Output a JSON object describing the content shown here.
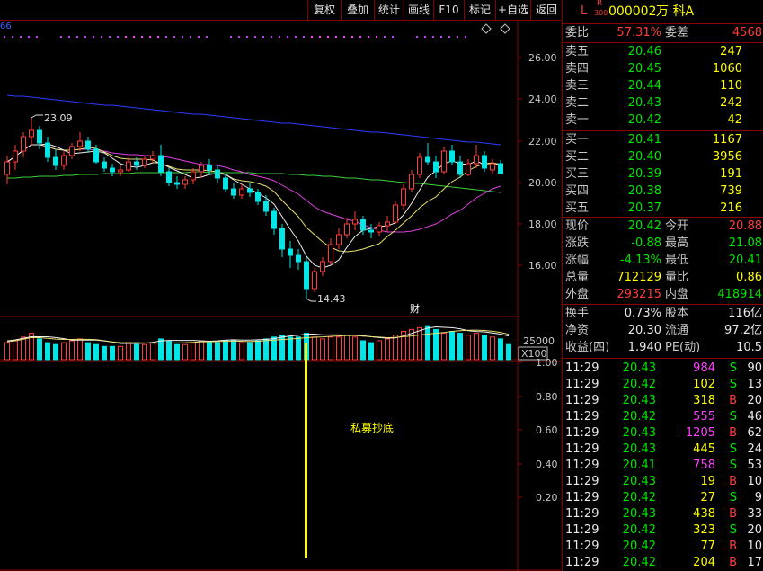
{
  "toolbar": {
    "buttons": [
      "复权",
      "叠加",
      "统计",
      "画线",
      "F10",
      "标记",
      "+自选",
      "返回"
    ]
  },
  "chart": {
    "top_label": "66",
    "price_ticks": [
      "26.00",
      "24.00",
      "22.00",
      "20.00",
      "18.00",
      "16.00"
    ],
    "high_annotation": "23.09",
    "low_annotation": "14.43",
    "cai_marker": "财",
    "volume_tick": "25000",
    "volume_unit": "X100",
    "indicator_ticks": [
      "1.00",
      "0.80",
      "0.60",
      "0.40",
      "0.20"
    ],
    "indicator_label": "私募抄底",
    "colors": {
      "up": "#ff3b3b",
      "down": "#00e5e5",
      "ma_blue": "#2a3cff",
      "ma_green": "#3cd23c",
      "ma_magenta": "#e040e0",
      "ma_yellow": "#e8e070",
      "ma_white": "#f0f0f0",
      "signal": "#ffff00",
      "grid": "#8b0000"
    },
    "candles": [
      {
        "o": 20.4,
        "h": 21.3,
        "l": 19.9,
        "c": 21.0
      },
      {
        "o": 21.0,
        "h": 21.8,
        "l": 20.6,
        "c": 21.5
      },
      {
        "o": 21.5,
        "h": 22.4,
        "l": 21.2,
        "c": 22.2
      },
      {
        "o": 22.2,
        "h": 23.09,
        "l": 21.8,
        "c": 22.5
      },
      {
        "o": 22.5,
        "h": 22.7,
        "l": 21.6,
        "c": 21.9
      },
      {
        "o": 21.9,
        "h": 22.2,
        "l": 21.0,
        "c": 21.2
      },
      {
        "o": 21.2,
        "h": 21.6,
        "l": 20.6,
        "c": 20.8
      },
      {
        "o": 20.8,
        "h": 21.5,
        "l": 20.6,
        "c": 21.3
      },
      {
        "o": 21.3,
        "h": 21.9,
        "l": 21.1,
        "c": 21.7
      },
      {
        "o": 21.7,
        "h": 22.4,
        "l": 21.5,
        "c": 22.0
      },
      {
        "o": 22.0,
        "h": 22.2,
        "l": 21.4,
        "c": 21.6
      },
      {
        "o": 21.6,
        "h": 21.8,
        "l": 20.9,
        "c": 21.0
      },
      {
        "o": 21.0,
        "h": 21.2,
        "l": 20.5,
        "c": 20.7
      },
      {
        "o": 20.7,
        "h": 20.9,
        "l": 20.3,
        "c": 20.5
      },
      {
        "o": 20.5,
        "h": 20.8,
        "l": 20.3,
        "c": 20.6
      },
      {
        "o": 20.6,
        "h": 21.2,
        "l": 20.5,
        "c": 21.0
      },
      {
        "o": 21.0,
        "h": 21.2,
        "l": 20.6,
        "c": 20.8
      },
      {
        "o": 20.8,
        "h": 21.3,
        "l": 20.7,
        "c": 21.1
      },
      {
        "o": 21.1,
        "h": 21.5,
        "l": 20.9,
        "c": 21.3
      },
      {
        "o": 21.3,
        "h": 21.8,
        "l": 20.3,
        "c": 20.5
      },
      {
        "o": 20.5,
        "h": 20.7,
        "l": 19.8,
        "c": 20.0
      },
      {
        "o": 20.0,
        "h": 20.3,
        "l": 19.7,
        "c": 19.9
      },
      {
        "o": 19.9,
        "h": 20.3,
        "l": 19.7,
        "c": 20.1
      },
      {
        "o": 20.1,
        "h": 20.7,
        "l": 19.9,
        "c": 20.5
      },
      {
        "o": 20.5,
        "h": 21.0,
        "l": 20.2,
        "c": 20.8
      },
      {
        "o": 20.8,
        "h": 21.1,
        "l": 20.4,
        "c": 20.6
      },
      {
        "o": 20.6,
        "h": 20.8,
        "l": 20.0,
        "c": 20.2
      },
      {
        "o": 20.2,
        "h": 20.4,
        "l": 19.5,
        "c": 19.7
      },
      {
        "o": 19.7,
        "h": 20.0,
        "l": 19.2,
        "c": 19.4
      },
      {
        "o": 19.4,
        "h": 19.9,
        "l": 19.2,
        "c": 19.7
      },
      {
        "o": 19.7,
        "h": 20.0,
        "l": 19.3,
        "c": 19.5
      },
      {
        "o": 19.5,
        "h": 19.7,
        "l": 18.9,
        "c": 19.1
      },
      {
        "o": 19.1,
        "h": 19.4,
        "l": 18.4,
        "c": 18.6
      },
      {
        "o": 18.6,
        "h": 18.8,
        "l": 17.5,
        "c": 17.8
      },
      {
        "o": 17.8,
        "h": 18.0,
        "l": 16.4,
        "c": 16.8
      },
      {
        "o": 16.8,
        "h": 17.2,
        "l": 15.9,
        "c": 16.5
      },
      {
        "o": 16.5,
        "h": 16.8,
        "l": 15.8,
        "c": 16.2
      },
      {
        "o": 16.2,
        "h": 16.4,
        "l": 14.43,
        "c": 14.9
      },
      {
        "o": 14.9,
        "h": 15.9,
        "l": 14.7,
        "c": 15.7
      },
      {
        "o": 15.7,
        "h": 16.4,
        "l": 15.5,
        "c": 16.2
      },
      {
        "o": 16.2,
        "h": 17.3,
        "l": 16.0,
        "c": 17.0
      },
      {
        "o": 17.0,
        "h": 17.8,
        "l": 16.8,
        "c": 17.5
      },
      {
        "o": 17.5,
        "h": 18.3,
        "l": 17.3,
        "c": 18.0
      },
      {
        "o": 18.0,
        "h": 18.6,
        "l": 17.7,
        "c": 18.2
      },
      {
        "o": 18.2,
        "h": 18.4,
        "l": 17.5,
        "c": 17.7
      },
      {
        "o": 17.7,
        "h": 18.0,
        "l": 17.3,
        "c": 17.6
      },
      {
        "o": 17.6,
        "h": 18.1,
        "l": 17.4,
        "c": 17.9
      },
      {
        "o": 17.9,
        "h": 18.4,
        "l": 17.6,
        "c": 18.1
      },
      {
        "o": 18.1,
        "h": 19.1,
        "l": 18.0,
        "c": 18.9
      },
      {
        "o": 18.9,
        "h": 19.9,
        "l": 18.7,
        "c": 19.7
      },
      {
        "o": 19.7,
        "h": 20.6,
        "l": 19.5,
        "c": 20.4
      },
      {
        "o": 20.4,
        "h": 21.4,
        "l": 20.2,
        "c": 21.2
      },
      {
        "o": 21.2,
        "h": 21.9,
        "l": 20.8,
        "c": 21.0
      },
      {
        "o": 21.0,
        "h": 21.3,
        "l": 20.2,
        "c": 20.5
      },
      {
        "o": 20.5,
        "h": 21.7,
        "l": 20.4,
        "c": 21.5
      },
      {
        "o": 21.5,
        "h": 21.8,
        "l": 20.8,
        "c": 21.0
      },
      {
        "o": 21.0,
        "h": 21.3,
        "l": 20.2,
        "c": 20.4
      },
      {
        "o": 20.4,
        "h": 21.1,
        "l": 20.3,
        "c": 20.9
      },
      {
        "o": 20.9,
        "h": 21.8,
        "l": 20.7,
        "c": 21.3
      },
      {
        "o": 21.3,
        "h": 21.5,
        "l": 20.5,
        "c": 20.7
      },
      {
        "o": 20.6,
        "h": 21.1,
        "l": 20.41,
        "c": 20.9
      },
      {
        "o": 20.9,
        "h": 21.08,
        "l": 20.41,
        "c": 20.42
      }
    ],
    "volumes": [
      9,
      10,
      12,
      14,
      11,
      9,
      8,
      9,
      10,
      11,
      9,
      8,
      7,
      7,
      7,
      9,
      8,
      8,
      9,
      11,
      10,
      8,
      8,
      9,
      10,
      9,
      9,
      10,
      10,
      9,
      9,
      10,
      11,
      12,
      13,
      12,
      12,
      14,
      12,
      11,
      12,
      12,
      13,
      12,
      10,
      9,
      10,
      11,
      13,
      15,
      16,
      17,
      18,
      16,
      14,
      15,
      14,
      13,
      14,
      13,
      12,
      11,
      8
    ],
    "signal_index": 37
  },
  "quote": {
    "l_badge": "L",
    "r_badge": "R",
    "r_sub": "300",
    "code": "000002",
    "name": "万 科A",
    "weibi_label": "委比",
    "weibi_value": "57.31%",
    "weicha_label": "委差",
    "weicha_value": "4568",
    "asks": [
      {
        "label": "卖五",
        "price": "20.46",
        "vol": "247"
      },
      {
        "label": "卖四",
        "price": "20.45",
        "vol": "1060"
      },
      {
        "label": "卖三",
        "price": "20.44",
        "vol": "110"
      },
      {
        "label": "卖二",
        "price": "20.43",
        "vol": "242"
      },
      {
        "label": "卖一",
        "price": "20.42",
        "vol": "42"
      }
    ],
    "bids": [
      {
        "label": "买一",
        "price": "20.41",
        "vol": "1167"
      },
      {
        "label": "买二",
        "price": "20.40",
        "vol": "3956"
      },
      {
        "label": "买三",
        "price": "20.39",
        "vol": "191"
      },
      {
        "label": "买四",
        "price": "20.38",
        "vol": "739"
      },
      {
        "label": "买五",
        "price": "20.37",
        "vol": "216"
      }
    ],
    "stats": [
      {
        "l1": "现价",
        "v1": "20.42",
        "c1": "green",
        "l2": "今开",
        "v2": "20.88",
        "c2": "red"
      },
      {
        "l1": "涨跌",
        "v1": "-0.88",
        "c1": "green",
        "l2": "最高",
        "v2": "21.08",
        "c2": "green"
      },
      {
        "l1": "涨幅",
        "v1": "-4.13%",
        "c1": "green",
        "l2": "最低",
        "v2": "20.41",
        "c2": "green"
      },
      {
        "l1": "总量",
        "v1": "712129",
        "c1": "yel",
        "l2": "量比",
        "v2": "0.86",
        "c2": "yel"
      },
      {
        "l1": "外盘",
        "v1": "293215",
        "c1": "red",
        "l2": "内盘",
        "v2": "418914",
        "c2": "green"
      }
    ],
    "fund": [
      {
        "l1": "换手",
        "v1": "0.73%",
        "l2": "股本",
        "v2": "116亿"
      },
      {
        "l1": "净资",
        "v1": "20.30",
        "l2": "流通",
        "v2": "97.2亿"
      },
      {
        "l1": "收益(四)",
        "v1": "1.940",
        "l2": "PE(动)",
        "v2": "10.5"
      }
    ]
  },
  "ticks": [
    {
      "time": "11:29",
      "price": "20.43",
      "vol": "984",
      "vc": "mag",
      "side": "S",
      "n": "90"
    },
    {
      "time": "11:29",
      "price": "20.42",
      "vol": "102",
      "vc": "yel",
      "side": "S",
      "n": "13"
    },
    {
      "time": "11:29",
      "price": "20.43",
      "vol": "318",
      "vc": "yel",
      "side": "B",
      "n": "20"
    },
    {
      "time": "11:29",
      "price": "20.42",
      "vol": "555",
      "vc": "mag",
      "side": "S",
      "n": "46"
    },
    {
      "time": "11:29",
      "price": "20.43",
      "vol": "1205",
      "vc": "mag",
      "side": "B",
      "n": "62"
    },
    {
      "time": "11:29",
      "price": "20.43",
      "vol": "445",
      "vc": "yel",
      "side": "S",
      "n": "24"
    },
    {
      "time": "11:29",
      "price": "20.41",
      "vol": "758",
      "vc": "mag",
      "side": "S",
      "n": "53"
    },
    {
      "time": "11:29",
      "price": "20.43",
      "vol": "19",
      "vc": "yel",
      "side": "B",
      "n": "10"
    },
    {
      "time": "11:29",
      "price": "20.42",
      "vol": "27",
      "vc": "yel",
      "side": "S",
      "n": "9"
    },
    {
      "time": "11:29",
      "price": "20.43",
      "vol": "438",
      "vc": "yel",
      "side": "B",
      "n": "33"
    },
    {
      "time": "11:29",
      "price": "20.42",
      "vol": "323",
      "vc": "yel",
      "side": "S",
      "n": "20"
    },
    {
      "time": "11:29",
      "price": "20.42",
      "vol": "77",
      "vc": "yel",
      "side": "B",
      "n": "10"
    },
    {
      "time": "11:29",
      "price": "20.42",
      "vol": "204",
      "vc": "yel",
      "side": "B",
      "n": "17"
    }
  ]
}
